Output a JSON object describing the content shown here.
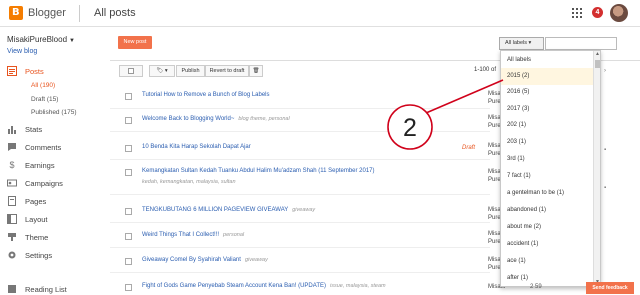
{
  "topbar": {
    "brand": "Blogger",
    "page_title": "All posts",
    "notification_count": "4"
  },
  "sidebar": {
    "blog_name": "MisakiPureBlood",
    "view_blog": "View blog",
    "nav": [
      {
        "label": "Posts",
        "icon": "posts-icon",
        "active": true
      },
      {
        "label": "Stats",
        "icon": "stats-icon"
      },
      {
        "label": "Comments",
        "icon": "comments-icon"
      },
      {
        "label": "Earnings",
        "icon": "earnings-icon"
      },
      {
        "label": "Campaigns",
        "icon": "campaigns-icon"
      },
      {
        "label": "Pages",
        "icon": "pages-icon"
      },
      {
        "label": "Layout",
        "icon": "layout-icon"
      },
      {
        "label": "Theme",
        "icon": "theme-icon"
      },
      {
        "label": "Settings",
        "icon": "settings-icon"
      },
      {
        "label": "Reading List",
        "icon": "reading-list-icon"
      }
    ],
    "subnav": [
      "All (190)",
      "Draft (15)",
      "Published (175)"
    ]
  },
  "toolbar": {
    "new_post": "New post",
    "publish": "Publish",
    "revert": "Revert to draft",
    "count": "1-100 of"
  },
  "posts": [
    {
      "title": "Tutorial How to Remove a Bunch of Blog Labels",
      "labels": "",
      "status": "",
      "author": "Misaki\nPure"
    },
    {
      "title": "Welcome Back to Blogging World~",
      "labels": "blog theme, personal",
      "status": "",
      "author": "Misaki\nPure"
    },
    {
      "title": "10 Benda Kita Harap Sekolah Dapat Ajar",
      "labels": "",
      "status": "Draft",
      "author": "Misaki\nPure"
    },
    {
      "title": "Kemangkatan Sultan Kedah Tuanku Abdul Halim Mu'adzam Shah (11 September 2017)",
      "labels": "kedah, kemangkatan, malaysia, sultan",
      "status": "",
      "author": "Misaki\nPure"
    },
    {
      "title": "TENGKUBUTANG 6 MILLION PAGEVIEW GIVEAWAY",
      "labels": "giveaway",
      "status": "",
      "author": "Misaki\nPure"
    },
    {
      "title": "Weird Things That I Collect!!!",
      "labels": "personal",
      "status": "",
      "author": "Misaki\nPure"
    },
    {
      "title": "Giveaway Comel By Syahirah Valiant",
      "labels": "giveaway",
      "status": "",
      "author": "Misaki\nPure"
    },
    {
      "title": "Fight of Gods Game Penyebab Steam Account Kena Ban! (UPDATE)",
      "labels": "issue, malaysia, steam",
      "status": "",
      "author": "Misaki"
    }
  ],
  "label_filter": {
    "button": "All labels",
    "selected_index": 1,
    "options": [
      "All labels",
      "2015 (2)",
      "2016 (5)",
      "2017 (3)",
      "202 (1)",
      "203 (1)",
      "3rd (1)",
      "7 fact (1)",
      "a gentelman to be (1)",
      "abandoned (1)",
      "about me (2)",
      "accident (1)",
      "ace (1)",
      "after (1)"
    ]
  },
  "annotation": {
    "number": "2",
    "color": "#d0021b"
  },
  "footer": {
    "stats": "2   59",
    "feedback": "Send feedback"
  },
  "colors": {
    "accent": "#f2724b",
    "link": "#2a5db0",
    "active_nav": "#e8541e"
  }
}
